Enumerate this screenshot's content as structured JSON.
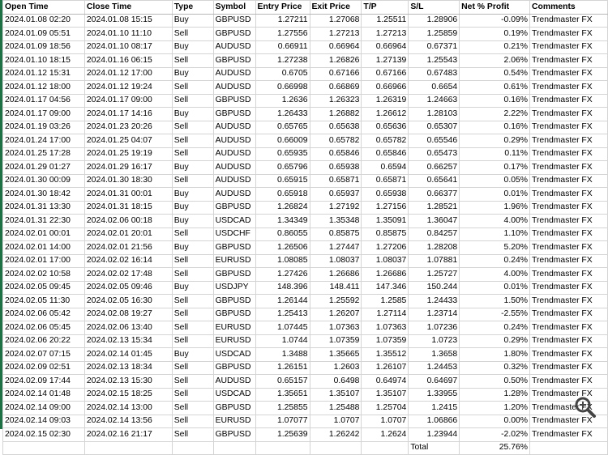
{
  "headers": [
    "Open Time",
    "Close Time",
    "Type",
    "Symbol",
    "Entry Price",
    "Exit Price",
    "T/P",
    "S/L",
    "Net % Profit",
    "Comments"
  ],
  "rows": [
    [
      "2024.01.08 02:20",
      "2024.01.08 15:15",
      "Buy",
      "GBPUSD",
      "1.27211",
      "1.27068",
      "1.25511",
      "1.28906",
      "-0.09%",
      "Trendmaster FX"
    ],
    [
      "2024.01.09 05:51",
      "2024.01.10 11:10",
      "Sell",
      "GBPUSD",
      "1.27556",
      "1.27213",
      "1.27213",
      "1.25859",
      "0.19%",
      "Trendmaster FX"
    ],
    [
      "2024.01.09 18:56",
      "2024.01.10 08:17",
      "Buy",
      "AUDUSD",
      "0.66911",
      "0.66964",
      "0.66964",
      "0.67371",
      "0.21%",
      "Trendmaster FX"
    ],
    [
      "2024.01.10 18:15",
      "2024.01.16 06:15",
      "Sell",
      "GBPUSD",
      "1.27238",
      "1.26826",
      "1.27139",
      "1.25543",
      "2.06%",
      "Trendmaster FX"
    ],
    [
      "2024.01.12 15:31",
      "2024.01.12 17:00",
      "Buy",
      "AUDUSD",
      "0.6705",
      "0.67166",
      "0.67166",
      "0.67483",
      "0.54%",
      "Trendmaster FX"
    ],
    [
      "2024.01.12 18:00",
      "2024.01.12 19:24",
      "Sell",
      "AUDUSD",
      "0.66998",
      "0.66869",
      "0.66966",
      "0.6654",
      "0.61%",
      "Trendmaster FX"
    ],
    [
      "2024.01.17 04:56",
      "2024.01.17 09:00",
      "Sell",
      "GBPUSD",
      "1.2636",
      "1.26323",
      "1.26319",
      "1.24663",
      "0.16%",
      "Trendmaster FX"
    ],
    [
      "2024.01.17 09:00",
      "2024.01.17 14:16",
      "Buy",
      "GBPUSD",
      "1.26433",
      "1.26882",
      "1.26612",
      "1.28103",
      "2.22%",
      "Trendmaster FX"
    ],
    [
      "2024.01.19 03:26",
      "2024.01.23 20:26",
      "Sell",
      "AUDUSD",
      "0.65765",
      "0.65638",
      "0.65636",
      "0.65307",
      "0.16%",
      "Trendmaster FX"
    ],
    [
      "2024.01.24 17:00",
      "2024.01.25 04:07",
      "Sell",
      "AUDUSD",
      "0.66009",
      "0.65782",
      "0.65782",
      "0.65546",
      "0.29%",
      "Trendmaster FX"
    ],
    [
      "2024.01.25 17:28",
      "2024.01.25 19:19",
      "Sell",
      "AUDUSD",
      "0.65935",
      "0.65846",
      "0.65846",
      "0.65473",
      "0.11%",
      "Trendmaster FX"
    ],
    [
      "2024.01.29 01:27",
      "2024.01.29 16:17",
      "Buy",
      "AUDUSD",
      "0.65796",
      "0.65938",
      "0.6594",
      "0.66257",
      "0.17%",
      "Trendmaster FX"
    ],
    [
      "2024.01.30 00:09",
      "2024.01.30 18:30",
      "Sell",
      "AUDUSD",
      "0.65915",
      "0.65871",
      "0.65871",
      "0.65641",
      "0.05%",
      "Trendmaster FX"
    ],
    [
      "2024.01.30 18:42",
      "2024.01.31 00:01",
      "Buy",
      "AUDUSD",
      "0.65918",
      "0.65937",
      "0.65938",
      "0.66377",
      "0.01%",
      "Trendmaster FX"
    ],
    [
      "2024.01.31 13:30",
      "2024.01.31 18:15",
      "Buy",
      "GBPUSD",
      "1.26824",
      "1.27192",
      "1.27156",
      "1.28521",
      "1.96%",
      "Trendmaster FX"
    ],
    [
      "2024.01.31 22:30",
      "2024.02.06 00:18",
      "Buy",
      "USDCAD",
      "1.34349",
      "1.35348",
      "1.35091",
      "1.36047",
      "4.00%",
      "Trendmaster FX"
    ],
    [
      "2024.02.01 00:01",
      "2024.02.01 20:01",
      "Sell",
      "USDCHF",
      "0.86055",
      "0.85875",
      "0.85875",
      "0.84257",
      "1.10%",
      "Trendmaster FX"
    ],
    [
      "2024.02.01 14:00",
      "2024.02.01 21:56",
      "Buy",
      "GBPUSD",
      "1.26506",
      "1.27447",
      "1.27206",
      "1.28208",
      "5.20%",
      "Trendmaster FX"
    ],
    [
      "2024.02.01 17:00",
      "2024.02.02 16:14",
      "Sell",
      "EURUSD",
      "1.08085",
      "1.08037",
      "1.08037",
      "1.07881",
      "0.24%",
      "Trendmaster FX"
    ],
    [
      "2024.02.02 10:58",
      "2024.02.02 17:48",
      "Sell",
      "GBPUSD",
      "1.27426",
      "1.26686",
      "1.26686",
      "1.25727",
      "4.00%",
      "Trendmaster FX"
    ],
    [
      "2024.02.05 09:45",
      "2024.02.05 09:46",
      "Buy",
      "USDJPY",
      "148.396",
      "148.411",
      "147.346",
      "150.244",
      "0.01%",
      "Trendmaster FX"
    ],
    [
      "2024.02.05 11:30",
      "2024.02.05 16:30",
      "Sell",
      "GBPUSD",
      "1.26144",
      "1.25592",
      "1.2585",
      "1.24433",
      "1.50%",
      "Trendmaster FX"
    ],
    [
      "2024.02.06 05:42",
      "2024.02.08 19:27",
      "Sell",
      "GBPUSD",
      "1.25413",
      "1.26207",
      "1.27114",
      "1.23714",
      "-2.55%",
      "Trendmaster FX"
    ],
    [
      "2024.02.06 05:45",
      "2024.02.06 13:40",
      "Sell",
      "EURUSD",
      "1.07445",
      "1.07363",
      "1.07363",
      "1.07236",
      "0.24%",
      "Trendmaster FX"
    ],
    [
      "2024.02.06 20:22",
      "2024.02.13 15:34",
      "Sell",
      "EURUSD",
      "1.0744",
      "1.07359",
      "1.07359",
      "1.0723",
      "0.29%",
      "Trendmaster FX"
    ],
    [
      "2024.02.07 07:15",
      "2024.02.14 01:45",
      "Buy",
      "USDCAD",
      "1.3488",
      "1.35665",
      "1.35512",
      "1.3658",
      "1.80%",
      "Trendmaster FX"
    ],
    [
      "2024.02.09 02:51",
      "2024.02.13 18:34",
      "Sell",
      "GBPUSD",
      "1.26151",
      "1.2603",
      "1.26107",
      "1.24453",
      "0.32%",
      "Trendmaster FX"
    ],
    [
      "2024.02.09 17:44",
      "2024.02.13 15:30",
      "Sell",
      "AUDUSD",
      "0.65157",
      "0.6498",
      "0.64974",
      "0.64697",
      "0.50%",
      "Trendmaster FX"
    ],
    [
      "2024.02.14 01:48",
      "2024.02.15 18:25",
      "Sell",
      "USDCAD",
      "1.35651",
      "1.35107",
      "1.35107",
      "1.33955",
      "1.28%",
      "Trendmaster FX"
    ],
    [
      "2024.02.14 09:00",
      "2024.02.14 13:00",
      "Sell",
      "GBPUSD",
      "1.25855",
      "1.25488",
      "1.25704",
      "1.2415",
      "1.20%",
      "Trendmaster FX"
    ],
    [
      "2024.02.14 09:03",
      "2024.02.14 13:56",
      "Sell",
      "EURUSD",
      "1.07077",
      "1.0707",
      "1.0707",
      "1.06866",
      "0.00%",
      "Trendmaster FX"
    ],
    [
      "2024.02.15 02:30",
      "2024.02.16 21:17",
      "Sell",
      "GBPUSD",
      "1.25639",
      "1.26242",
      "1.2624",
      "1.23944",
      "-2.02%",
      "Trendmaster FX"
    ]
  ],
  "total": {
    "label": "Total",
    "value": "25.76%"
  },
  "icons": {
    "zoom": "zoom-in-icon"
  },
  "colors": {
    "edge": "#1e7145",
    "grid": "#d4d4d4"
  }
}
